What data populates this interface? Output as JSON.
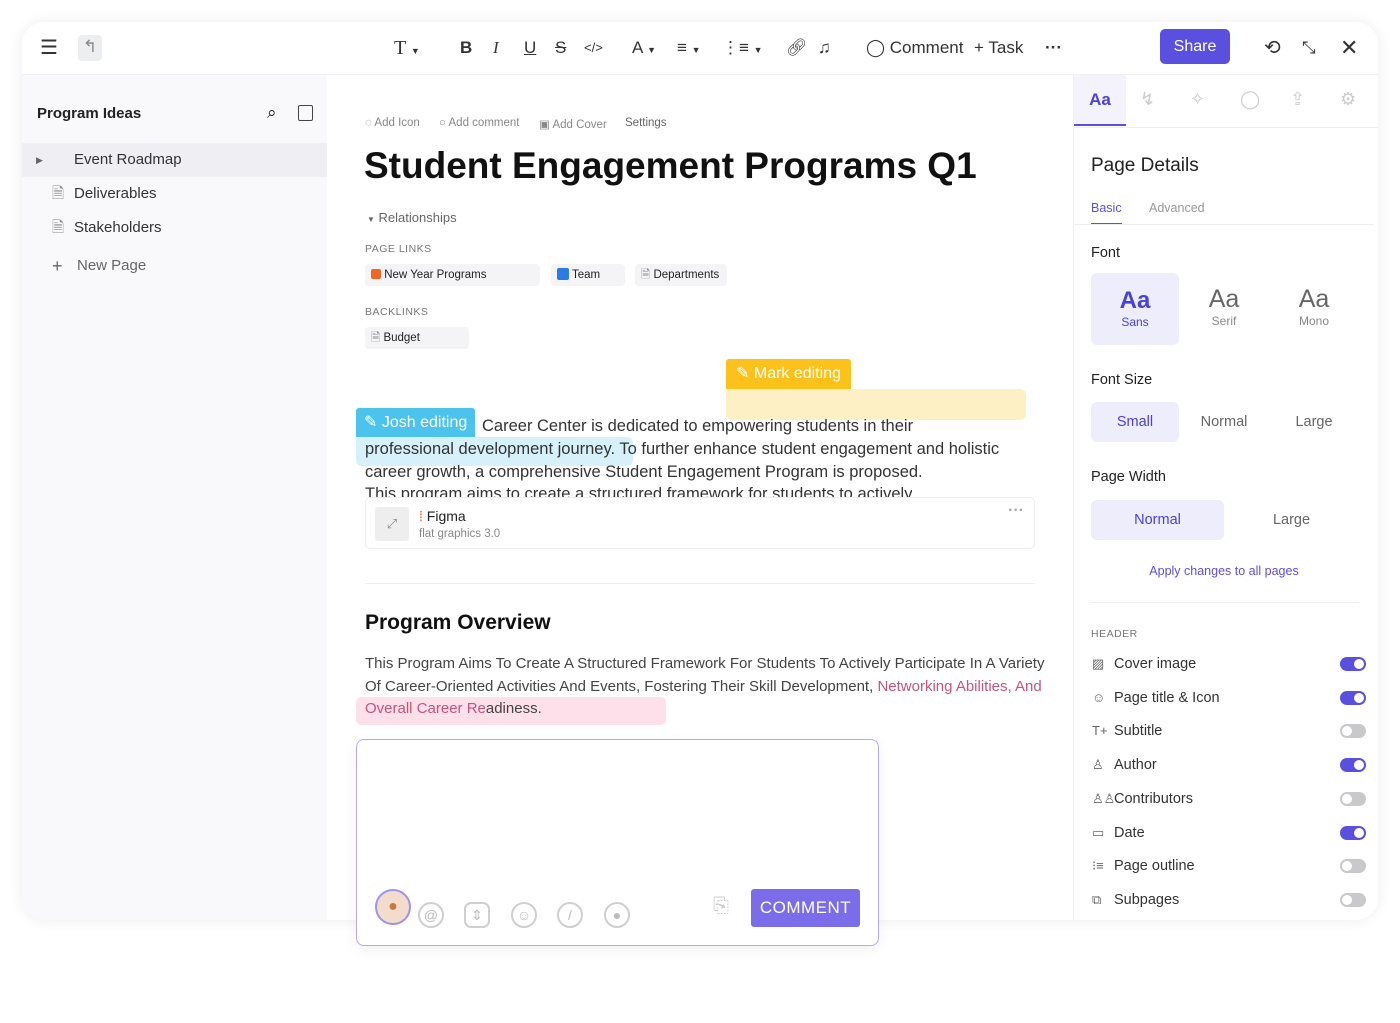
{
  "toolbar": {
    "text_style": "T",
    "comment": "Comment",
    "task": "Task",
    "share": "Share",
    "more": "···"
  },
  "sidebar": {
    "title": "Program Ideas",
    "items": [
      {
        "label": "Event Roadmap"
      },
      {
        "label": "Deliverables"
      },
      {
        "label": "Stakeholders"
      }
    ],
    "new_page": "New Page"
  },
  "doc": {
    "actions": [
      "Add Icon",
      "Add comment",
      "Add Cover",
      "Settings"
    ],
    "title": "Student Engagement Programs Q1",
    "relationships": "Relationships",
    "page_links_label": "PAGE LINKS",
    "page_links": [
      "New Year Programs",
      "Team",
      "Departments"
    ],
    "backlinks_label": "BACKLINKS",
    "backlinks": [
      "Budget"
    ],
    "mark_editing": "Mark editing",
    "josh_editing": "Josh editing",
    "para1_a": "Career Center is dedicated to empowering students in their",
    "para1_b": "professional development journey.",
    "para1_c": " To further enhance student engagement and holistic career growth, a comprehensive Student Engagement Program is proposed.",
    "para1_d": "This program aims to create a structured framework for students to actively",
    "embed_title": "Figma",
    "embed_sub": "flat graphics 3.0",
    "section_title": "Program Overview",
    "para2_a": "This Program Aims To Create A Structured Framework For Students To Actively Participate In A Variety Of Career-Oriented Activities And Events, Fostering Their Skill Development, ",
    "para2_b": "Networking Abilities, And Overall Career Re",
    "para2_c": "adiness."
  },
  "comment_box": {
    "submit": "COMMENT"
  },
  "panel": {
    "tab_aa": "Aa",
    "title": "Page Details",
    "tabs": [
      "Basic",
      "Advanced"
    ],
    "font_label": "Font",
    "fonts": [
      {
        "aa": "Aa",
        "name": "Sans"
      },
      {
        "aa": "Aa",
        "name": "Serif"
      },
      {
        "aa": "Aa",
        "name": "Mono"
      }
    ],
    "size_label": "Font Size",
    "sizes": [
      "Small",
      "Normal",
      "Large"
    ],
    "width_label": "Page Width",
    "widths": [
      "Normal",
      "Large"
    ],
    "apply": "Apply changes to all pages",
    "header_label": "HEADER",
    "header_items": [
      {
        "label": "Cover image",
        "on": true
      },
      {
        "label": "Page title & Icon",
        "on": true
      },
      {
        "label": "Subtitle",
        "on": false
      },
      {
        "label": "Author",
        "on": true
      },
      {
        "label": "Contributors",
        "on": false
      },
      {
        "label": "Date",
        "on": true
      },
      {
        "label": "Page outline",
        "on": false
      },
      {
        "label": "Subpages",
        "on": false
      }
    ]
  },
  "colors": {
    "accent": "#5b4fe0",
    "mark": "#fcc21b",
    "josh": "#4cc3ec"
  }
}
